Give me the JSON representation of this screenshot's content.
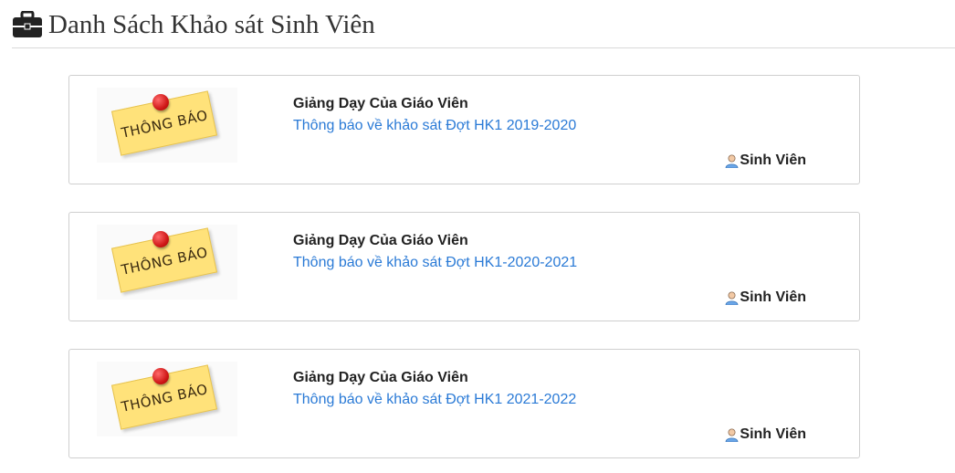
{
  "page": {
    "title": "Danh Sách Khảo sát Sinh Viên",
    "title_icon": "briefcase-icon"
  },
  "surveys": [
    {
      "thumbnail_text": "THÔNG BÁO",
      "title": "Giảng Dạy Của Giáo Viên",
      "link": "Thông báo về khảo sát Đợt HK1 2019-2020",
      "role": "Sinh Viên"
    },
    {
      "thumbnail_text": "THÔNG BÁO",
      "title": "Giảng Dạy Của Giáo Viên",
      "link": "Thông báo về khảo sát Đợt HK1-2020-2021",
      "role": "Sinh Viên"
    },
    {
      "thumbnail_text": "THÔNG BÁO",
      "title": "Giảng Dạy Của Giáo Viên",
      "link": "Thông báo về khảo sát Đợt HK1 2021-2022",
      "role": "Sinh Viên"
    }
  ],
  "colors": {
    "link": "#2a7ad6",
    "note": "#ffe27a",
    "pin": "#d01818"
  },
  "icons": {
    "role": "user-icon",
    "thumbnail": "sticky-note-pin-image"
  }
}
